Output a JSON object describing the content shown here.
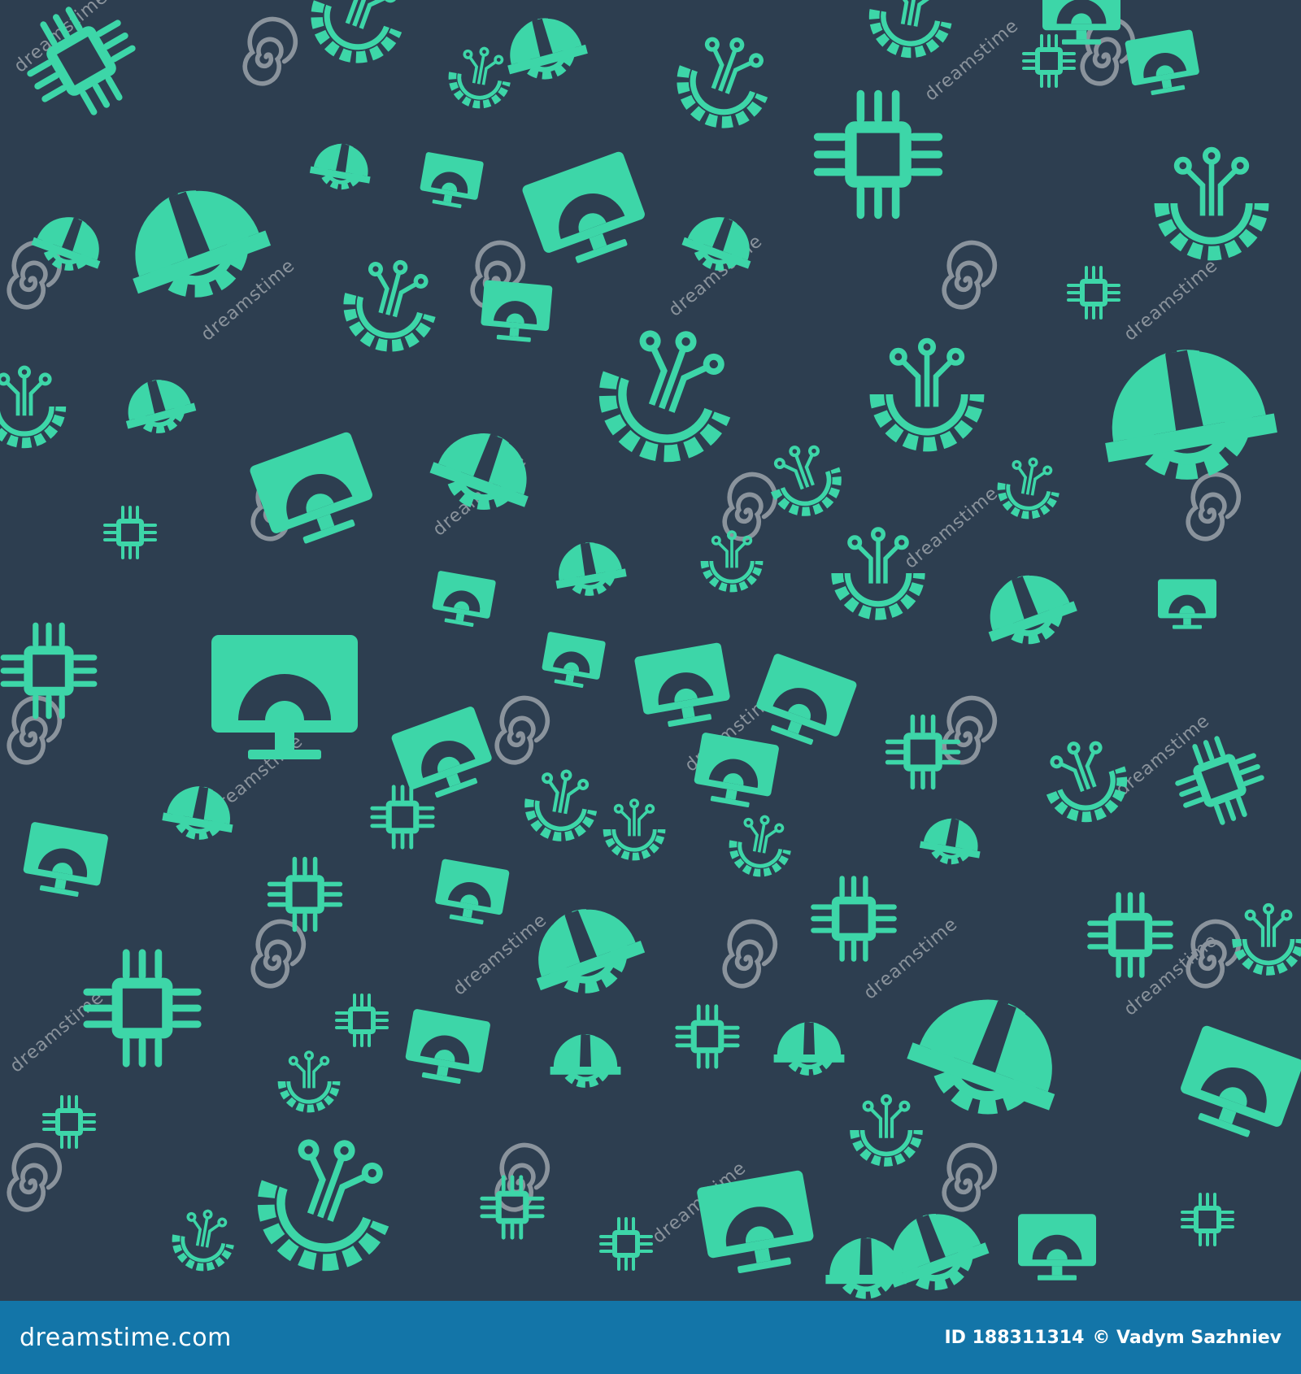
{
  "colors": {
    "background": "#2d3e50",
    "icon": "#3dd6a8",
    "watermark": "#8a939c",
    "footer": "#1375a8",
    "footer_text": "#ffffff"
  },
  "watermark": {
    "text": "dreamstime",
    "spiral_icon": "spiral-icon"
  },
  "icon_names": [
    "cpu-chip-icon",
    "gear-helmet-icon",
    "gear-circuit-icon",
    "monitor-gear-icon"
  ],
  "footer": {
    "logo_text": "dreamstime.com",
    "id_text": "ID 188311314",
    "credit_text": "© Vadym Sazhniev"
  }
}
